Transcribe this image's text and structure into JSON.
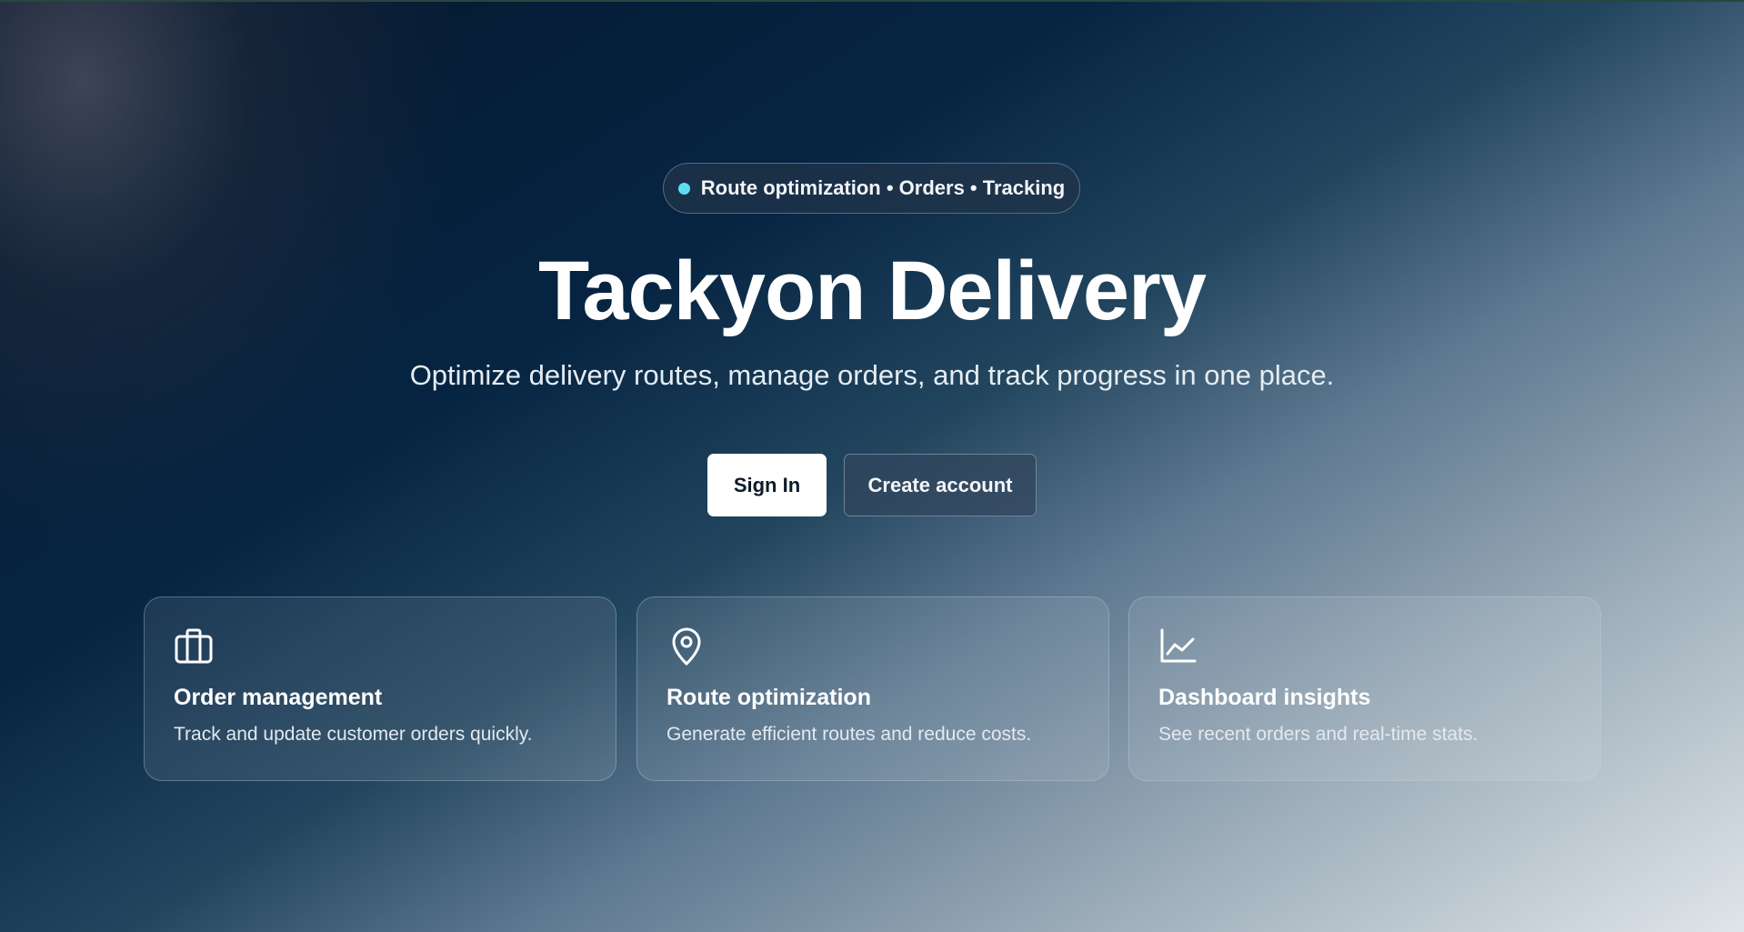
{
  "hero": {
    "badge_text": "Route optimization • Orders • Tracking",
    "title": "Tackyon Delivery",
    "subtitle": "Optimize delivery routes, manage orders, and track progress in one place."
  },
  "actions": {
    "sign_in_label": "Sign In",
    "create_account_label": "Create account"
  },
  "features": [
    {
      "icon": "briefcase-icon",
      "title": "Order management",
      "description": "Track and update customer orders quickly."
    },
    {
      "icon": "map-pin-icon",
      "title": "Route optimization",
      "description": "Generate efficient routes and reduce costs."
    },
    {
      "icon": "line-chart-icon",
      "title": "Dashboard insights",
      "description": "See recent orders and real-time stats."
    }
  ],
  "colors": {
    "accent_dot": "#5fdcf2",
    "background_dark": "#062543",
    "background_light": "#dfe5ea"
  }
}
